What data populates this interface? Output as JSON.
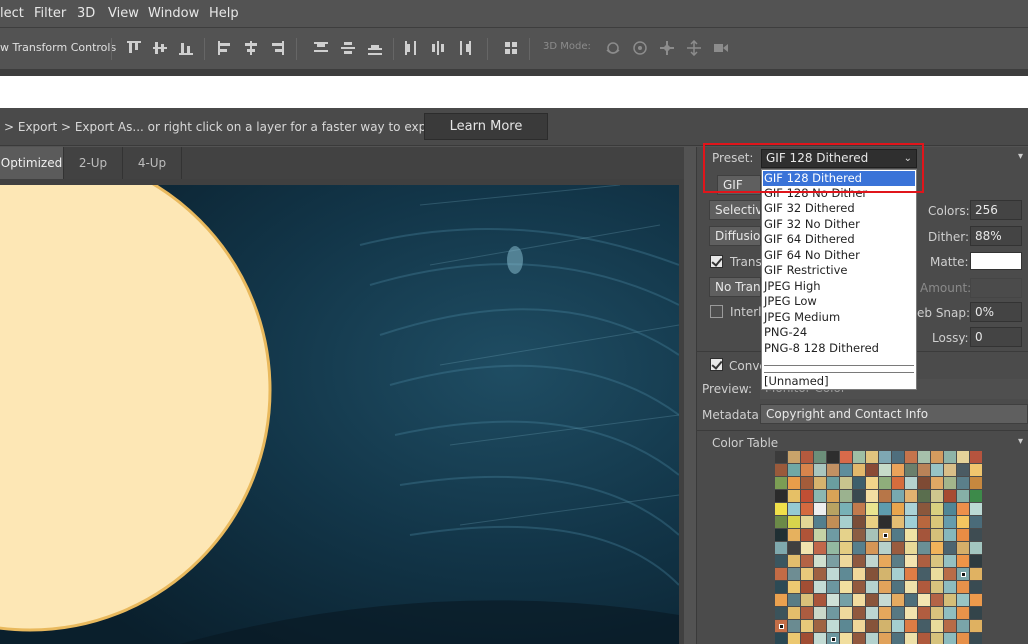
{
  "menu": [
    "lect",
    "Filter",
    "3D",
    "View",
    "Window",
    "Help"
  ],
  "options_bar": {
    "transform_label": "w Transform Controls",
    "mode_3d_label": "3D Mode:"
  },
  "info_bar": {
    "text": "> Export > Export As...  or right click on a layer for a faster way to export assets",
    "learn_more": "Learn More"
  },
  "tabs": [
    "Optimized",
    "2-Up",
    "4-Up"
  ],
  "panel": {
    "preset_label": "Preset:",
    "preset_value": "GIF 128 Dithered",
    "format_value": "GIF",
    "reduction_value": "Selective",
    "dither_algo_value": "Diffusion",
    "transparency_label": "Transp",
    "transparency_dither_value": "No Transp",
    "interlaced_label": "Interla",
    "colors_label": "Colors:",
    "colors_value": "256",
    "dither_label": "Dither:",
    "dither_value": "88%",
    "matte_label": "Matte:",
    "amount_label": "Amount:",
    "websnap_label": "eb Snap:",
    "websnap_value": "0%",
    "lossy_label": "Lossy:",
    "lossy_value": "0",
    "convert_label": "Conve",
    "preview_label": "Preview:",
    "preview_value": "Monitor Color",
    "metadata_label": "Metadata:",
    "metadata_value": "Copyright and Contact Info",
    "color_table_label": "Color Table"
  },
  "preset_dropdown": {
    "items": [
      "GIF 128 Dithered",
      "GIF 128 No Dither",
      "GIF 32 Dithered",
      "GIF 32 No Dither",
      "GIF 64 Dithered",
      "GIF 64 No Dither",
      "GIF Restrictive",
      "JPEG High",
      "JPEG Low",
      "JPEG Medium",
      "PNG-24",
      "PNG-8 128 Dithered"
    ],
    "selected": "GIF 128 Dithered",
    "extra_item": "[Unnamed]"
  },
  "colors": {
    "highlight": "#3a73d8",
    "callout": "#e0151b",
    "moon": "#fde7b5",
    "sky": "#0f2b3c"
  },
  "color_table": [
    "#3b3b3b",
    "#c9a36a",
    "#b55a3e",
    "#6c8f7a",
    "#2e2e2e",
    "#d86a4a",
    "#9fbfa4",
    "#e1c47e",
    "#7ea7b3",
    "#4f6e7d",
    "#c5744c",
    "#a6c0ab",
    "#d49b5e",
    "#8eb4a8",
    "#e5d39a",
    "#b6543e",
    "#9a5a3b",
    "#6fa8a6",
    "#d7844c",
    "#a9c6bf",
    "#c29163",
    "#5e8d9c",
    "#e3b86b",
    "#8a4b36",
    "#c7dbc8",
    "#e9a25a",
    "#6b7f6c",
    "#b98258",
    "#97c3c6",
    "#d9be88",
    "#4b5b63",
    "#f0c56e",
    "#7c9e54",
    "#e89d4a",
    "#a35c3a",
    "#d6b36e",
    "#6a9ea0",
    "#c9c48e",
    "#3e5f6c",
    "#f2d58a",
    "#8fae7b",
    "#d56d3d",
    "#b5d2cf",
    "#7e4a34",
    "#e0a864",
    "#a3b58b",
    "#5b7f8a",
    "#c7883f",
    "#2b2b2b",
    "#e6c066",
    "#c04f34",
    "#8cb7b1",
    "#d9a357",
    "#9bb28f",
    "#3a4a50",
    "#f3dea2",
    "#b77648",
    "#78a9af",
    "#e1b270",
    "#5a6e4e",
    "#cfc78e",
    "#a64b31",
    "#86b0a7",
    "#3d8a4a",
    "#f0e04a",
    "#95c9d2",
    "#d4693f",
    "#eee",
    "#b8a262",
    "#78b1b6",
    "#c27a4d",
    "#eae48f",
    "#5e9cad",
    "#e8a54d",
    "#abd2d6",
    "#8a573c",
    "#d8d080",
    "#4f8696",
    "#ec8f4b",
    "#bbd9d4",
    "#6b8a48",
    "#d8d44c",
    "#e2d596",
    "#547f8e",
    "#c28e56",
    "#a7cfcd",
    "#7a4e39",
    "#ead083",
    "#2d2d2d",
    "#e3bd73",
    "#9ed0d8",
    "#b8673e",
    "#d9c679",
    "#659cac",
    "#f3c560",
    "#4a6b79",
    "#1f2f33",
    "#e6b15e",
    "#b05438",
    "#c6d3a6",
    "#6f9ba3",
    "#e5d28b",
    "#8b5d43",
    "#a7c3b9",
    "#ddb368",
    "#537a87",
    "#efe2a4",
    "#a4553b",
    "#d4c07a",
    "#86b7bb",
    "#e98c44",
    "#3e4c52",
    "#7fa9ad",
    "#3f3f3f",
    "#f1e3ae",
    "#c1674a",
    "#93b9a1",
    "#e4cc82",
    "#577f8c",
    "#d59656",
    "#b7d1ca",
    "#9a5c3f",
    "#e8da98",
    "#6a8f95",
    "#f0b35a",
    "#4d6470",
    "#d6ae69",
    "#a3c6c0",
    "#3a5660",
    "#e2bd6d",
    "#b36345",
    "#d0e0cf",
    "#7b9fa2",
    "#eed89c",
    "#8f5940",
    "#c0d6d0",
    "#e7a85b",
    "#5b7d86",
    "#f4e4b0",
    "#ad5f41",
    "#d9c47f",
    "#94c0c2",
    "#ee9448",
    "#2f3c40",
    "#c36b45",
    "#6e8d93",
    "#e8c97b",
    "#9e6142",
    "#bfd9d4",
    "#5f8a95",
    "#f0d79a",
    "#845239",
    "#d3b46d",
    "#a6cfd0",
    "#df7d45",
    "#475e67",
    "#eadc9c",
    "#b86c48",
    "#7ca6aa",
    "#e0b262",
    "#2c4a55",
    "#edc971",
    "#a24e34",
    "#c4dcd5",
    "#6c97a0",
    "#f2df9f",
    "#93593e",
    "#b5d3cf",
    "#e2a35b",
    "#50737f",
    "#efe1aa",
    "#b05a3d",
    "#d7c37d",
    "#8dbcbf",
    "#e8914a",
    "#394b52",
    "#eaa14f",
    "#5a7c85",
    "#d8c07a",
    "#a9553a",
    "#cfe0d6",
    "#75a0a6",
    "#f1dca0",
    "#8a553b",
    "#c6dad3",
    "#e5aa60",
    "#4e6f7b",
    "#f3e5b2",
    "#b36447",
    "#d5be78",
    "#98c4c5",
    "#ec9a4c",
    "#3b535b",
    "#e4bd6b",
    "#ac5c40",
    "#cad8c9",
    "#7099a0",
    "#efd99c",
    "#91583e",
    "#bdd6d1",
    "#e6a75c",
    "#577882",
    "#f2e3ae",
    "#b15d40",
    "#d8c27d",
    "#90bec0",
    "#e9934a",
    "#33444a",
    "#c46e47",
    "#6a8b91",
    "#e7c87a",
    "#9f6343",
    "#c0dad5",
    "#5c8893",
    "#efd699",
    "#86533a",
    "#d2b36c",
    "#a4cecf",
    "#de7c44",
    "#465d66",
    "#e9db9b",
    "#b76b47",
    "#7aa5a9",
    "#dfb161",
    "#2a4853",
    "#ecc870",
    "#a14d33",
    "#c3dbd4",
    "#6b969f",
    "#f1de9e",
    "#92583d",
    "#b4d2ce",
    "#e1a25a",
    "#4f727e",
    "#eee0a9",
    "#af593c",
    "#d6c27c",
    "#8cbbbe",
    "#e79049",
    "#384a51"
  ],
  "color_table_marks": [
    104,
    158,
    208,
    228,
    259,
    276,
    300,
    330,
    349,
    360,
    371,
    398
  ]
}
